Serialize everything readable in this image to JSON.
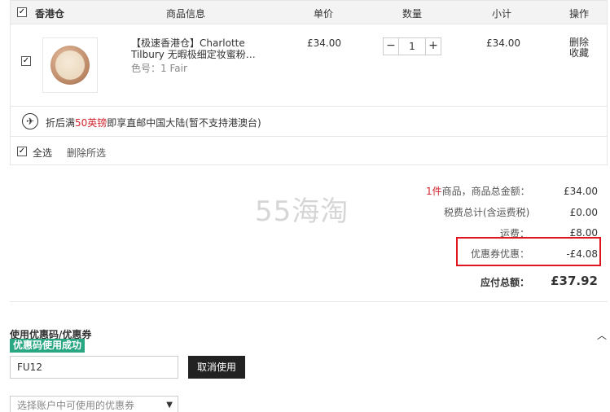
{
  "cart": {
    "warehouse_label": "香港仓",
    "columns": {
      "product_info": "商品信息",
      "unit_price": "单价",
      "quantity": "数量",
      "subtotal": "小计",
      "actions": "操作"
    },
    "item": {
      "title_line1": "【极速香港仓】Charlotte",
      "title_line2": "Tilbury 无暇极细定妆蜜粉…",
      "variant_label": "色号：",
      "variant_value": "1 Fair",
      "unit_price": "£34.00",
      "quantity": "1",
      "subtotal": "£34.00",
      "delete_label": "删除",
      "favorite_label": "收藏",
      "minus": "−",
      "plus": "+"
    },
    "shipping_notice": {
      "prefix": "折后满",
      "highlight": "50英镑",
      "suffix": "即享直邮中国大陆(暂不支持港澳台)"
    },
    "select_all_label": "全选",
    "delete_selected_label": "删除所选"
  },
  "watermark": "55海淘",
  "summary": {
    "item_count": "1件",
    "goods_total_label": "商品，商品总金额：",
    "goods_total_value": "£34.00",
    "tax_label": "税费总计(含运费税)",
    "tax_value": "£0.00",
    "shipping_label": "运费：",
    "shipping_value": "£8.00",
    "discount_label": "优惠券优惠：",
    "discount_value": "-£4.08",
    "total_label": "应付总额：",
    "total_value": "£37.92"
  },
  "coupon": {
    "title": "使用优惠码/优惠券",
    "success_badge": "优惠码使用成功",
    "code_value": "FU12",
    "cancel_label": "取消使用",
    "select_placeholder": "选择账户中可使用的优惠券"
  },
  "colors": {
    "accent_red": "#d2242c",
    "success_green": "#29a783",
    "button_dark": "#222222"
  },
  "icons": {
    "checkbox": "checkbox-checked-icon",
    "airplane": "airplane-icon",
    "chevron": "chevron-up-icon",
    "dropdown": "caret-down-icon"
  }
}
